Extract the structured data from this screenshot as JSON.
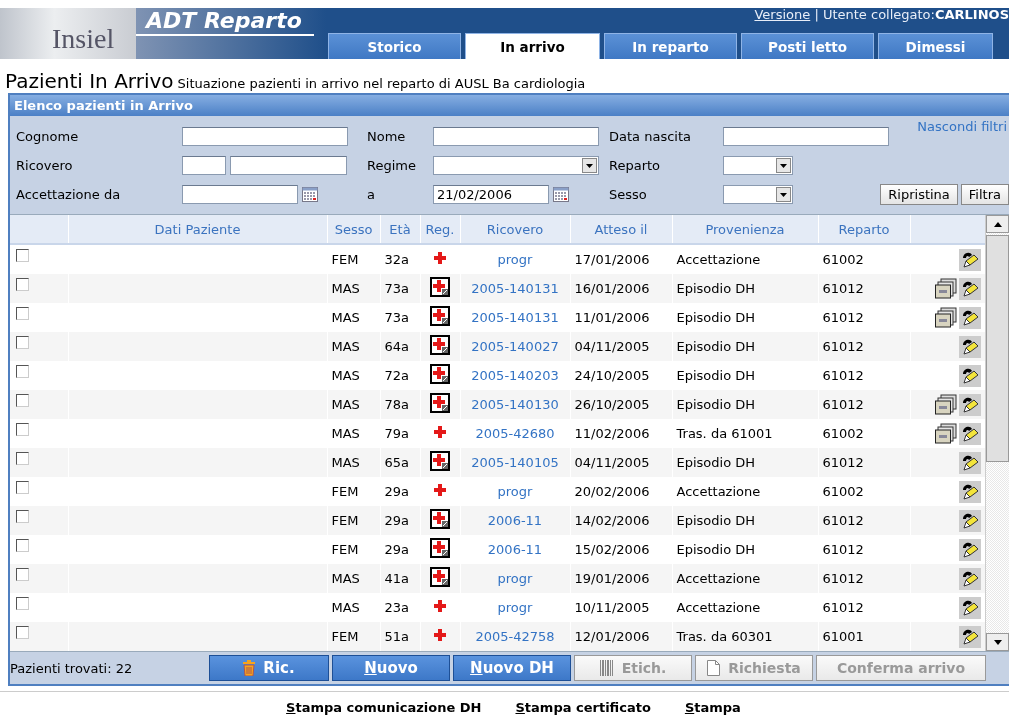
{
  "header": {
    "logo": "Insiel",
    "app_title": "ADT Reparto",
    "version_link": "Versione",
    "separator": "|",
    "user_label": "Utente collegato:",
    "user_name": "CARLINOS"
  },
  "tabs": [
    {
      "label": "Storico",
      "selected": false
    },
    {
      "label": "In arrivo",
      "selected": true
    },
    {
      "label": "In reparto",
      "selected": false
    },
    {
      "label": "Posti letto",
      "selected": false
    },
    {
      "label": "Dimessi",
      "selected": false
    }
  ],
  "page": {
    "title": "Pazienti In Arrivo",
    "subtitle": "Situazione pazienti in arrivo nel reparto di AUSL Ba cardiologia"
  },
  "panel": {
    "title": "Elenco pazienti in Arrivo"
  },
  "filters": {
    "hide_link": "Nascondi filtri",
    "fields": [
      {
        "label": "Cognome",
        "kind": "text"
      },
      {
        "label": "Nome",
        "kind": "text"
      },
      {
        "label": "Data nascita",
        "kind": "text"
      },
      {
        "label": "Ricovero",
        "kind": "split"
      },
      {
        "label": "Regime",
        "kind": "select"
      },
      {
        "label": "Reparto",
        "kind": "select-small"
      },
      {
        "label": "Accettazione da",
        "kind": "date"
      },
      {
        "label": "a",
        "kind": "date",
        "value": "21/02/2006"
      },
      {
        "label": "Sesso",
        "kind": "select-small"
      }
    ],
    "buttons": [
      "Ripristina",
      "Filtra"
    ]
  },
  "table": {
    "columns": [
      "Dati Paziente",
      "Sesso",
      "Età",
      "Reg.",
      "Ricovero",
      "Atteso il",
      "Provenienza",
      "Reparto"
    ],
    "rows": [
      {
        "checked": false,
        "sex": "FEM",
        "age": "32a",
        "kind": "cross",
        "ricovero": "progr",
        "expected": "17/01/2006",
        "origin": "Accettazione",
        "ward": "61002",
        "documents": false
      },
      {
        "checked": false,
        "sex": "MAS",
        "age": "73a",
        "kind": "kit",
        "ricovero": "2005-140131",
        "expected": "16/01/2006",
        "origin": "Episodio DH",
        "ward": "61012",
        "documents": true
      },
      {
        "checked": false,
        "sex": "MAS",
        "age": "73a",
        "kind": "kit",
        "ricovero": "2005-140131",
        "expected": "11/01/2006",
        "origin": "Episodio DH",
        "ward": "61012",
        "documents": true
      },
      {
        "checked": false,
        "sex": "MAS",
        "age": "64a",
        "kind": "kit",
        "ricovero": "2005-140027",
        "expected": "04/11/2005",
        "origin": "Episodio DH",
        "ward": "61012",
        "documents": false
      },
      {
        "checked": false,
        "sex": "MAS",
        "age": "72a",
        "kind": "kit",
        "ricovero": "2005-140203",
        "expected": "24/10/2005",
        "origin": "Episodio DH",
        "ward": "61012",
        "documents": false
      },
      {
        "checked": false,
        "sex": "MAS",
        "age": "78a",
        "kind": "kit",
        "ricovero": "2005-140130",
        "expected": "26/10/2005",
        "origin": "Episodio DH",
        "ward": "61012",
        "documents": true
      },
      {
        "checked": false,
        "sex": "MAS",
        "age": "79a",
        "kind": "cross",
        "ricovero": "2005-42680",
        "expected": "11/02/2006",
        "origin": "Tras. da 61001",
        "ward": "61002",
        "documents": true
      },
      {
        "checked": false,
        "sex": "MAS",
        "age": "65a",
        "kind": "kit",
        "ricovero": "2005-140105",
        "expected": "04/11/2005",
        "origin": "Episodio DH",
        "ward": "61012",
        "documents": false
      },
      {
        "checked": false,
        "sex": "FEM",
        "age": "29a",
        "kind": "cross",
        "ricovero": "progr",
        "expected": "20/02/2006",
        "origin": "Accettazione",
        "ward": "61002",
        "documents": false
      },
      {
        "checked": false,
        "sex": "FEM",
        "age": "29a",
        "kind": "kit",
        "ricovero": "2006-11",
        "expected": "14/02/2006",
        "origin": "Episodio DH",
        "ward": "61012",
        "documents": false
      },
      {
        "checked": false,
        "sex": "FEM",
        "age": "29a",
        "kind": "kit",
        "ricovero": "2006-11",
        "expected": "15/02/2006",
        "origin": "Episodio DH",
        "ward": "61012",
        "documents": false
      },
      {
        "checked": false,
        "sex": "MAS",
        "age": "41a",
        "kind": "kit",
        "ricovero": "progr",
        "expected": "19/01/2006",
        "origin": "Accettazione",
        "ward": "61012",
        "documents": false
      },
      {
        "checked": false,
        "sex": "MAS",
        "age": "23a",
        "kind": "cross",
        "ricovero": "progr",
        "expected": "10/11/2005",
        "origin": "Accettazione",
        "ward": "61012",
        "documents": false
      },
      {
        "checked": false,
        "sex": "FEM",
        "age": "51a",
        "kind": "cross",
        "ricovero": "2005-42758",
        "expected": "12/01/2006",
        "origin": "Tras. da 60301",
        "ward": "61001",
        "documents": false
      }
    ]
  },
  "status": {
    "found": "Pazienti trovati: 22"
  },
  "actions": [
    {
      "label": "Ric.",
      "kind": "trash",
      "disabled": false,
      "access_key": false
    },
    {
      "label": "Nuovo",
      "kind": "plain",
      "disabled": false,
      "access_key": true
    },
    {
      "label": "Nuovo DH",
      "kind": "plain",
      "disabled": false,
      "access_key": true
    },
    {
      "label": "Etich.",
      "kind": "barcode",
      "disabled": true,
      "access_key": false
    },
    {
      "label": "Richiesta",
      "kind": "page",
      "disabled": true,
      "access_key": false
    },
    {
      "label": "Conferma arrivo",
      "kind": "plain",
      "disabled": true,
      "access_key": false
    }
  ],
  "print_links": [
    {
      "label": "Stampa comunicazione DH",
      "access_key": true
    },
    {
      "label": "Stampa certificato",
      "access_key": true
    },
    {
      "label": "Stampa",
      "access_key": true
    }
  ]
}
